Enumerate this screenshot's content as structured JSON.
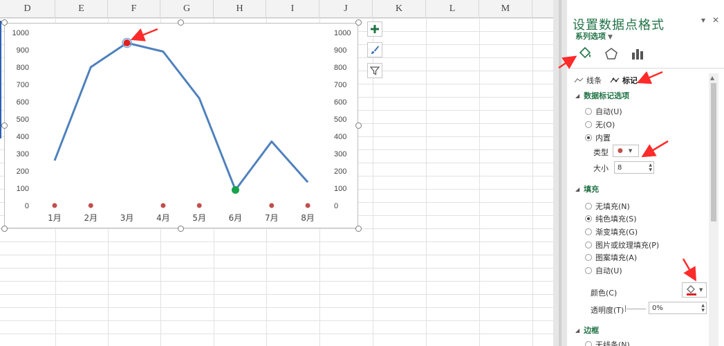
{
  "columns": [
    "D",
    "E",
    "F",
    "G",
    "H",
    "I",
    "J",
    "K",
    "L",
    "M"
  ],
  "chart_data": {
    "type": "line",
    "categories": [
      "1月",
      "2月",
      "3月",
      "4月",
      "5月",
      "6月",
      "7月",
      "8月"
    ],
    "series": [
      {
        "values": [
          260,
          800,
          940,
          890,
          620,
          90,
          370,
          135
        ]
      },
      {
        "values": [
          0,
          0,
          null,
          0,
          0,
          null,
          0,
          0
        ]
      }
    ],
    "highlight": {
      "max_index": 2,
      "min_index": 5,
      "max_color": "#e02020",
      "min_color": "#16a34a"
    },
    "line_color": "#4f81bd",
    "marker_color": "#c0504d",
    "y_ticks": [
      "1000",
      "900",
      "800",
      "700",
      "600",
      "500",
      "400",
      "300",
      "200",
      "100",
      "0"
    ],
    "ylim": [
      0,
      1000
    ],
    "secondary_axis": true
  },
  "chart_tools": [
    {
      "name": "chart-elements-button",
      "icon": "plus-icon"
    },
    {
      "name": "chart-styles-button",
      "icon": "brush-icon"
    },
    {
      "name": "chart-filters-button",
      "icon": "filter-icon"
    }
  ],
  "panel": {
    "title": "设置数据点格式",
    "subtitle": "系列选项",
    "tabs": {
      "line": "线条",
      "marker": "标记"
    },
    "marker_options": {
      "heading": "数据标记选项",
      "auto": "自动(U)",
      "none": "无(O)",
      "builtin": "内置",
      "type_label": "类型",
      "size_label": "大小",
      "size_value": "8"
    },
    "fill": {
      "heading": "填充",
      "no_fill": "无填充(N)",
      "solid_fill": "纯色填充(S)",
      "gradient_fill": "渐变填充(G)",
      "picture_fill": "图片或纹理填充(P)",
      "pattern_fill": "图案填充(A)",
      "auto": "自动(U)",
      "color_label": "颜色(C)",
      "transparency_label": "透明度(T)",
      "transparency_value": "0%"
    },
    "border": {
      "heading": "边框",
      "no_line": "无线条(N)"
    }
  },
  "colors": {
    "accent_green": "#217346",
    "annotation_red": "#ff2a2a"
  }
}
